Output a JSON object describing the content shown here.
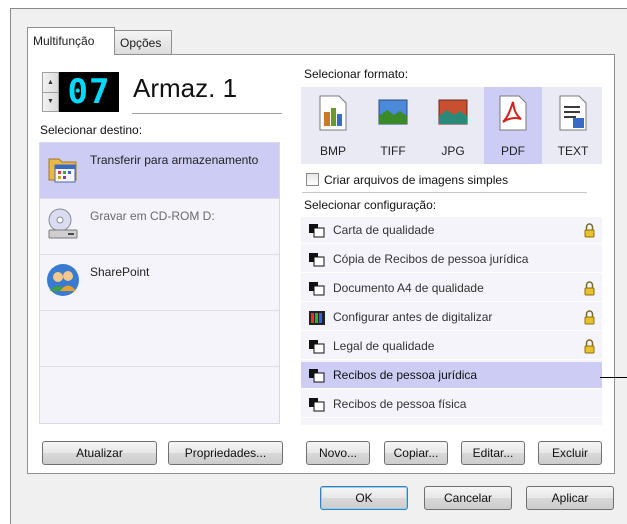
{
  "tabs": [
    {
      "label": "Multifunção"
    },
    {
      "label": "Opções"
    }
  ],
  "storage": {
    "number": "07",
    "title": "Armaz. 1"
  },
  "destination": {
    "label": "Selecionar destino:",
    "items": [
      {
        "label": "Transferir para armazenamento",
        "icon": "folder-calendar-icon",
        "selected": true
      },
      {
        "label": "Gravar em CD-ROM  D:",
        "icon": "cd-rom-drive-icon",
        "disabled": true
      },
      {
        "label": "SharePoint",
        "icon": "sharepoint-people-icon"
      }
    ]
  },
  "buttons": {
    "refresh": "Atualizar",
    "properties": "Propriedades...",
    "new": "Novo...",
    "copy": "Copiar...",
    "edit": "Editar...",
    "delete": "Excluir",
    "ok": "OK",
    "cancel": "Cancelar",
    "apply": "Aplicar"
  },
  "format": {
    "label": "Selecionar formato:",
    "items": [
      {
        "label": "BMP",
        "icon": "bmp-paint-icon"
      },
      {
        "label": "TIFF",
        "icon": "tiff-image-icon"
      },
      {
        "label": "JPG",
        "icon": "jpg-image-icon"
      },
      {
        "label": "PDF",
        "icon": "pdf-acrobat-icon",
        "selected": true
      },
      {
        "label": "TEXT",
        "icon": "text-document-icon"
      }
    ]
  },
  "simple_images_checkbox": {
    "label": "Criar arquivos de imagens simples",
    "checked": false
  },
  "configuration": {
    "label": "Selecionar configuração:",
    "items": [
      {
        "label": "Carta de qualidade",
        "icon": "scanner-bw-icon",
        "locked": true
      },
      {
        "label": "Cópia de Recibos de pessoa jurídica",
        "icon": "scanner-bw-icon",
        "locked": false
      },
      {
        "label": "Documento A4 de qualidade",
        "icon": "scanner-bw-icon",
        "locked": true
      },
      {
        "label": "Configurar antes de digitalizar",
        "icon": "color-configure-icon",
        "locked": true
      },
      {
        "label": "Legal de qualidade",
        "icon": "scanner-bw-icon",
        "locked": true
      },
      {
        "label": "Recibos de pessoa jurídica",
        "icon": "scanner-bw-icon",
        "locked": false,
        "selected": true
      },
      {
        "label": "Recibos de pessoa física",
        "icon": "scanner-bw-icon",
        "locked": false
      }
    ]
  },
  "colors": {
    "selection": "#ccccf4",
    "lcd_digits": "#00d9ff",
    "list_background": "#f4f4fa"
  }
}
